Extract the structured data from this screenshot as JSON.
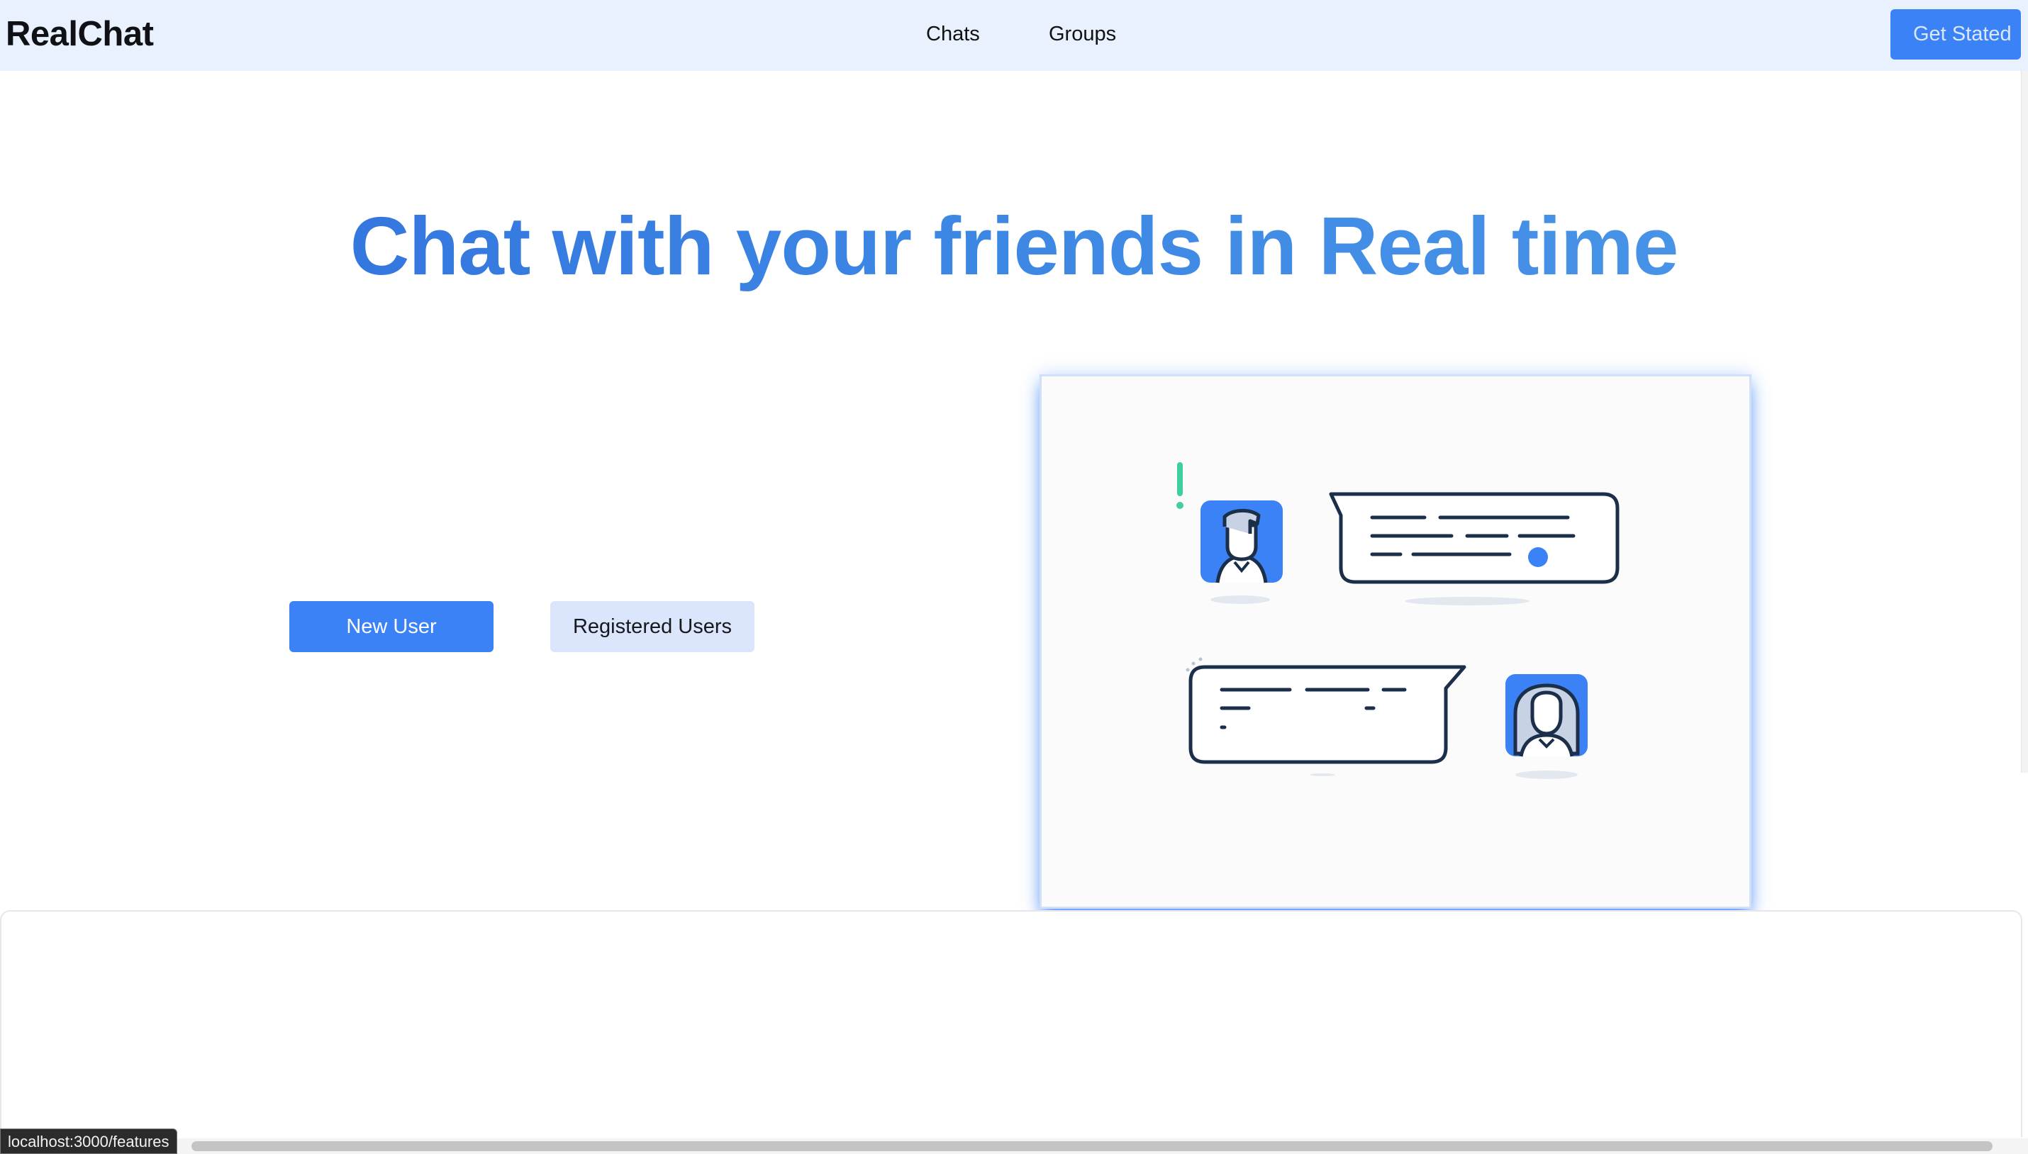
{
  "navbar": {
    "brand": "RealChat",
    "links": [
      "Chats",
      "Groups"
    ],
    "cta_label": "Get Stated"
  },
  "hero": {
    "title": "Chat with your friends in Real time",
    "buttons": {
      "new_user": "New User",
      "registered_users": "Registered Users"
    }
  },
  "illustration": {
    "description_icons": [
      "exclamation-icon",
      "male-avatar-icon",
      "female-avatar-icon",
      "chat-bubble-icon"
    ]
  },
  "status_bar": {
    "url": "localhost:3000/features"
  },
  "colors": {
    "accent": "#3b82f6",
    "navbar_bg": "#e8f1fd",
    "secondary_btn_bg": "#dbe5fb",
    "illustration_stroke": "#1b2f4a",
    "exclamation": "#3fcf9a"
  }
}
